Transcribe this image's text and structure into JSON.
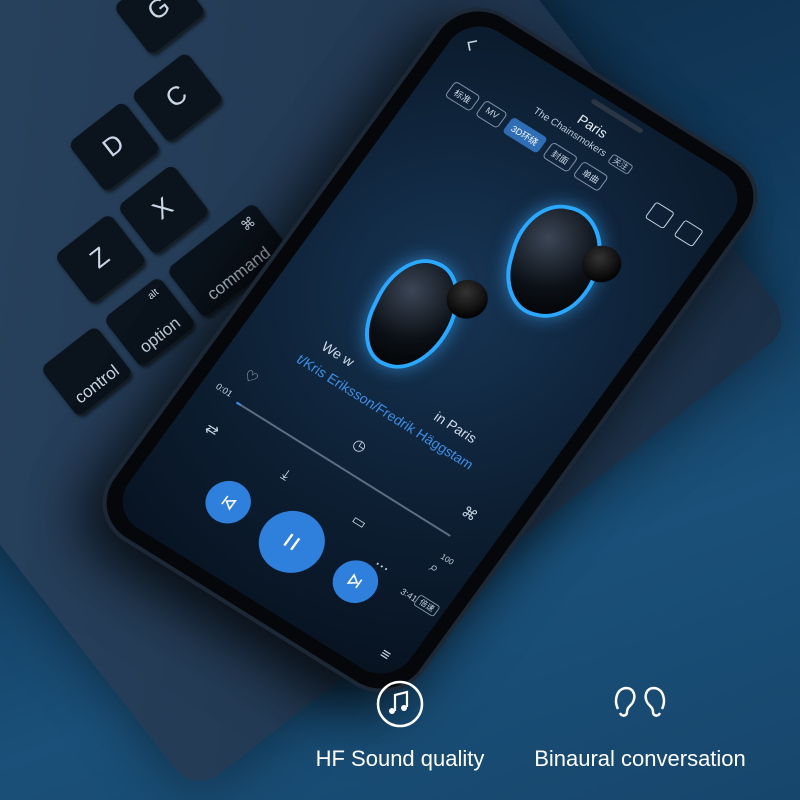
{
  "keyboard": {
    "keys": [
      {
        "glyph": "G"
      },
      {
        "glyph": "D"
      },
      {
        "glyph": "C"
      },
      {
        "glyph": "X"
      },
      {
        "glyph": "Z"
      },
      {
        "glyph": "⌘",
        "label": "command"
      },
      {
        "glyph": "alt",
        "label": "option"
      },
      {
        "label": "control"
      }
    ]
  },
  "player": {
    "song_title": "Paris",
    "artist": "The Chainsmokers",
    "follow_label": "关注",
    "chips": [
      "标准",
      "MV",
      "3D环绕",
      "封面",
      "单曲"
    ],
    "lyric_line_1": "We w",
    "lyric_line_1_end": "in Paris",
    "lyric_line_2": "t/Kris Eriksson/Fredrik Häggstam",
    "time_elapsed": "0:01",
    "time_total": "3:41",
    "progress_fraction": 0.02,
    "speed_label": "倍速",
    "count_label": "100",
    "more_label": "...",
    "accent_color": "#2f7fdc"
  },
  "features": [
    {
      "icon": "music-note-icon",
      "label": "HF Sound quality"
    },
    {
      "icon": "ears-icon",
      "label": "Binaural conversation"
    }
  ]
}
